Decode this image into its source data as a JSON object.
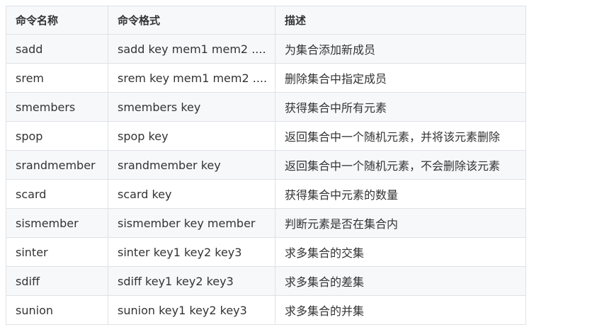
{
  "table": {
    "headers": [
      "命令名称",
      "命令格式",
      "描述"
    ],
    "rows": [
      [
        "sadd",
        "sadd key mem1 mem2 ....",
        "为集合添加新成员"
      ],
      [
        "srem",
        "srem key mem1 mem2 ....",
        "删除集合中指定成员"
      ],
      [
        "smembers",
        "smembers key",
        "获得集合中所有元素"
      ],
      [
        "spop",
        "spop key",
        "返回集合中一个随机元素，并将该元素删除"
      ],
      [
        "srandmember",
        "srandmember key",
        "返回集合中一个随机元素，不会删除该元素"
      ],
      [
        "scard",
        "scard key",
        "获得集合中元素的数量"
      ],
      [
        "sismember",
        "sismember key member",
        "判断元素是否在集合内"
      ],
      [
        "sinter",
        "sinter key1 key2 key3",
        "求多集合的交集"
      ],
      [
        "sdiff",
        "sdiff key1 key2 key3",
        "求多集合的差集"
      ],
      [
        "sunion",
        "sunion key1 key2 key3",
        "求多集合的并集"
      ]
    ]
  }
}
